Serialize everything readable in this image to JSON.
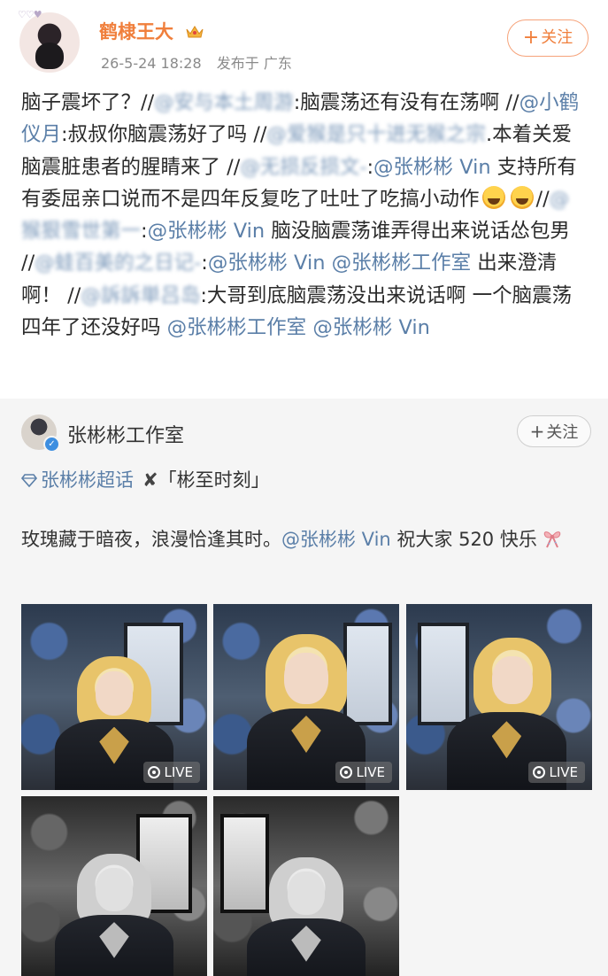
{
  "post": {
    "username": "鹤棣王大",
    "avatar_deco": "♡♡♥",
    "timestamp": "26-5-24 18:28",
    "location": "发布于 广东",
    "follow_label": "关注",
    "follow_plus": "+",
    "icons": {
      "crown": "crown-icon",
      "plus": "plus-icon"
    }
  },
  "body": {
    "t1": "脑子震坏了？//",
    "m1": "@安与本土周游",
    "t2": ":脑震荡还有没有在荡啊 //",
    "m2": "@小鹤仪月",
    "t3": ":叔叔你脑震荡好了吗 //",
    "m3": "@爱猴是只十进无猴之宗",
    "t4": ".本着关爱脑震脏患者的腥睛来了 //",
    "m4": "@无损反损文-",
    "t5": ":",
    "m5": "@张彬彬 Vin",
    "t6": " 支持所有有委屈亲口说而不是四年反复吃了吐吐了吃搞小动作",
    "t7": "//",
    "m6": "@猴狠雪世第一",
    "t8": ":",
    "m7": "@张彬彬 Vin",
    "t9": " 脑没脑震荡谁弄得出来说话怂包男 //",
    "m8": "@蛙百美的之日记-",
    "t10": ":",
    "m9": "@张彬彬 Vin",
    "t11": " ",
    "m10": "@张彬彬工作室",
    "t12": " 出来澄清啊！ //",
    "m11": "@訴訴単吕岛",
    "t13": ":大哥到底脑震荡没出来说话啊 一个脑震荡四年了还没好吗 ",
    "m12": "@张彬彬工作室",
    "t14": " ",
    "m13": "@张彬彬 Vin",
    "emoji": "tears-face-icon"
  },
  "repost": {
    "name": "张彬彬工作室",
    "verified_mark": "✓",
    "follow_label": "关注",
    "follow_plus": "+",
    "topic_link": "张彬彬超话",
    "topic_x": "✘",
    "topic_plain": "「彬至时刻」",
    "text_a": "玫瑰藏于暗夜，浪漫恰逢其时。",
    "text_mention": "@张彬彬 Vin",
    "text_b": " 祝大家 520 快乐",
    "gift": "gift-bow-icon",
    "live_label": "LIVE",
    "photos": [
      {
        "style": "color",
        "live": true
      },
      {
        "style": "color",
        "live": true
      },
      {
        "style": "color",
        "live": true
      },
      {
        "style": "bw",
        "live": false
      },
      {
        "style": "bw",
        "live": false
      }
    ]
  },
  "colors": {
    "username": "#f07f3c",
    "mention": "#5b7fa8",
    "meta": "#8a8a8a",
    "repost_bg": "#f5f5f5"
  }
}
